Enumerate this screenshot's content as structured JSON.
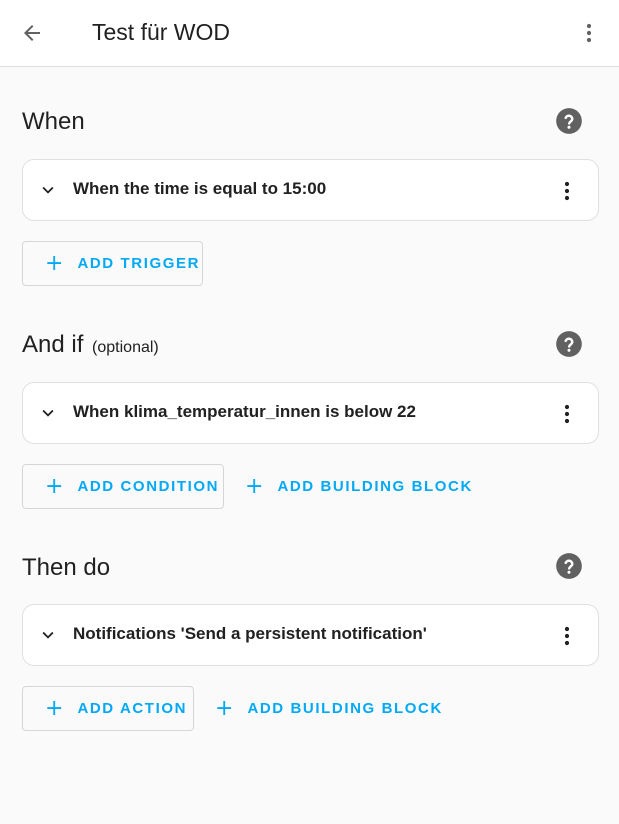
{
  "header": {
    "title": "Test für WOD",
    "back_icon": "arrow-left-icon",
    "menu_icon": "dots-vertical-icon"
  },
  "sections": {
    "triggers": {
      "title": "When",
      "help_icon": "help-circle-icon",
      "card_label": "When the time is equal to 15:00",
      "add_button": "ADD TRIGGER"
    },
    "conditions": {
      "title": "And if",
      "optional": "(optional)",
      "help_icon": "help-circle-icon",
      "card_label": "When klima_temperatur_innen is below 22",
      "add_button": "ADD CONDITION",
      "building_block_button": "ADD BUILDING BLOCK"
    },
    "actions": {
      "title": "Then do",
      "help_icon": "help-circle-icon",
      "card_label": "Notifications 'Send a persistent notification'",
      "add_button": "ADD ACTION",
      "building_block_button": "ADD BUILDING BLOCK"
    }
  },
  "colors": {
    "accent": "#03a9f4",
    "icon": "#616161",
    "background": "#fafafa"
  }
}
